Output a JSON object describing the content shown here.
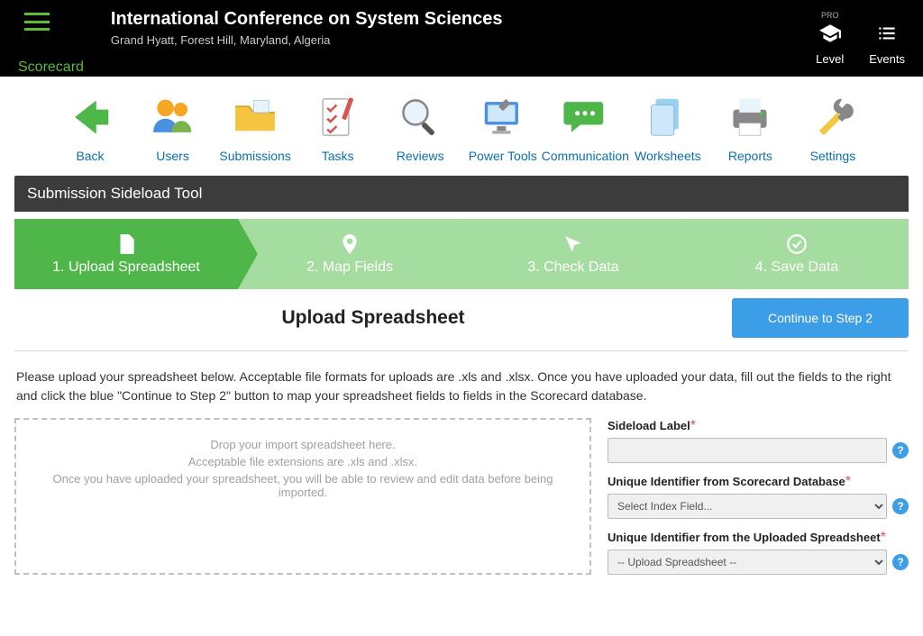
{
  "header": {
    "brand": "Scorecard",
    "title": "International Conference on System Sciences",
    "subtitle": "Grand Hyatt, Forest Hill, Maryland, Algeria",
    "pro_label": "PRO",
    "level_label": "Level",
    "events_label": "Events"
  },
  "toolbar": {
    "back": "Back",
    "users": "Users",
    "submissions": "Submissions",
    "tasks": "Tasks",
    "reviews": "Reviews",
    "power_tools": "Power Tools",
    "communication": "Communication",
    "worksheets": "Worksheets",
    "reports": "Reports",
    "settings": "Settings"
  },
  "section_title": "Submission Sideload Tool",
  "steps": {
    "s1": "1. Upload Spreadsheet",
    "s2": "2. Map Fields",
    "s3": "3. Check Data",
    "s4": "4. Save Data"
  },
  "page_title": "Upload Spreadsheet",
  "continue_label": "Continue to Step 2",
  "instructions": "Please upload your spreadsheet below. Acceptable file formats for uploads are .xls and .xlsx. Once you have uploaded your data, fill out the fields to the right and click the blue \"Continue to Step 2\" button to map your spreadsheet fields to fields in the Scorecard database.",
  "dropzone": {
    "line1": "Drop your import spreadsheet here.",
    "line2": "Acceptable file extensions are .xls and .xlsx.",
    "line3": "Once you have uploaded your spreadsheet, you will be able to review and edit data before being imported."
  },
  "form": {
    "sideload_label": "Sideload Label",
    "db_id_label": "Unique Identifier from Scorecard Database",
    "db_id_placeholder": "Select Index Field...",
    "upload_id_label": "Unique Identifier from the Uploaded Spreadsheet",
    "upload_id_placeholder": "-- Upload Spreadsheet --",
    "help": "?"
  }
}
